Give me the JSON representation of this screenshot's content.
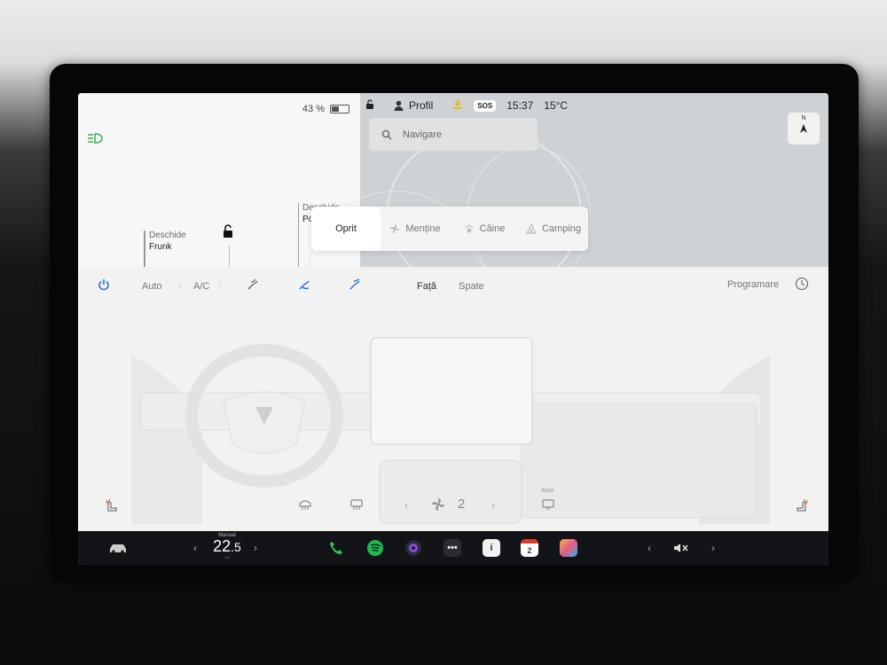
{
  "status": {
    "battery_text": "43 %",
    "battery_level": 0.43,
    "profile_label": "Profil",
    "sos_label": "SOS",
    "time": "15:37",
    "temperature": "15°C"
  },
  "car_panel": {
    "frunk_action": "Deschide",
    "frunk_label": "Frunk",
    "trunk_action": "Deschide",
    "trunk_label_partial": "Po"
  },
  "navigation": {
    "search_placeholder": "Navigare",
    "compass_n": "N"
  },
  "climate_mode": {
    "options": [
      "Oprit",
      "Menține",
      "Câine",
      "Camping"
    ],
    "selected": "Oprit"
  },
  "climate": {
    "auto_label": "Auto",
    "ac_label": "A/C",
    "front_label": "Față",
    "rear_label": "Spate",
    "schedule_label": "Programare",
    "fan_speed": "2",
    "auto_small": "Auto"
  },
  "dock": {
    "temp_mode": "Manual",
    "temp_int": "22",
    "temp_dec": ".5",
    "calendar_day": "2"
  },
  "colors": {
    "accent_blue": "#2a6fd6",
    "phone_green": "#34c759",
    "spotify_green": "#1db954",
    "seat_heat_orange": "#e0652a"
  }
}
